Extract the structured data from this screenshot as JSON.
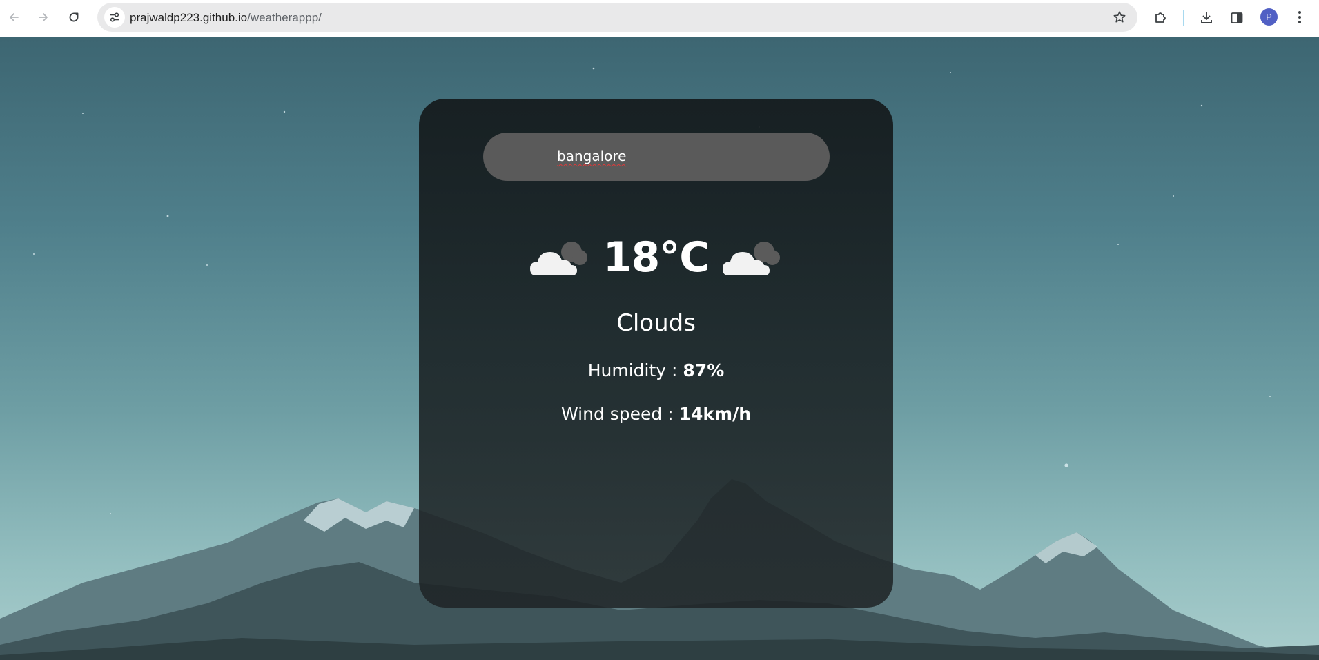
{
  "browser": {
    "url_host": "prajwaldp223.github.io",
    "url_path": "/weatherappp/",
    "profile_initial": "P"
  },
  "weather": {
    "search_value": "bangalore",
    "temperature": "18°C",
    "condition": "Clouds",
    "humidity_label": "Humidity : ",
    "humidity_value": "87%",
    "wind_label": "Wind speed : ",
    "wind_value": "14km/h",
    "weather_icon": "cloud-icon"
  },
  "colors": {
    "card_bg": "#1a2022",
    "search_bg": "#5a5a5a",
    "text": "#ffffff",
    "profile": "#5160c4"
  }
}
